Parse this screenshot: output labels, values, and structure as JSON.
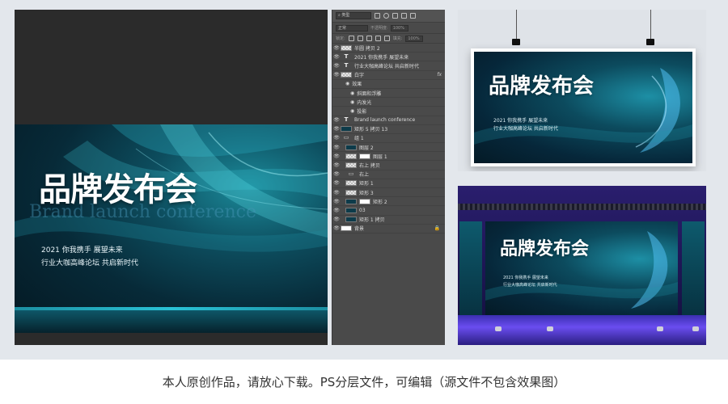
{
  "artwork": {
    "title": "品牌发布会",
    "subtitle_en": "Brand launch conference",
    "line1": "2021 你我携手 展望未来",
    "line2": "行业大咖高峰论坛 共启新时代"
  },
  "layers_panel": {
    "filter_label": "类型",
    "blend_mode": "正常",
    "opacity_label": "不透明度:",
    "opacity_value": "100%",
    "lock_label": "锁定:",
    "fill_label": "填充:",
    "fill_value": "100%",
    "layers": [
      {
        "name": "半圆 拷贝 2",
        "thumb": "checker",
        "indent": 0
      },
      {
        "name": "2021 你我携手 展望未来",
        "thumb": "text",
        "indent": 0
      },
      {
        "name": "行业大咖高峰论坛 共启新时代",
        "thumb": "text",
        "indent": 0
      },
      {
        "name": "白字",
        "thumb": "checker",
        "indent": 0,
        "fx": "fx"
      },
      {
        "name": "效果",
        "thumb": "none",
        "indent": 1
      },
      {
        "name": "斜面和浮雕",
        "thumb": "none",
        "indent": 2
      },
      {
        "name": "内发光",
        "thumb": "none",
        "indent": 2
      },
      {
        "name": "投影",
        "thumb": "none",
        "indent": 2
      },
      {
        "name": "Brand launch conference",
        "thumb": "text",
        "indent": 0
      },
      {
        "name": "矩形 5 拷贝 13",
        "thumb": "dark",
        "indent": 0
      },
      {
        "name": "组 1",
        "thumb": "folder",
        "indent": 0
      },
      {
        "name": "图层 2",
        "thumb": "dark",
        "indent": 1
      },
      {
        "name": "图层 1",
        "thumb": "checker",
        "indent": 1,
        "mask": true
      },
      {
        "name": "右上 拷贝",
        "thumb": "checker",
        "indent": 1
      },
      {
        "name": "右上",
        "thumb": "folder",
        "indent": 1
      },
      {
        "name": "矩形 1",
        "thumb": "checker",
        "indent": 1
      },
      {
        "name": "矩形 3",
        "thumb": "checker",
        "indent": 1
      },
      {
        "name": "矩形 2",
        "thumb": "dark",
        "indent": 1,
        "mask": true
      },
      {
        "name": "03",
        "thumb": "dark",
        "indent": 1
      },
      {
        "name": "矩形 1 拷贝",
        "thumb": "dark",
        "indent": 1
      },
      {
        "name": "背景",
        "thumb": "white",
        "indent": 0,
        "locked": true
      }
    ]
  },
  "caption": "本人原创作品，请放心下载。PS分层文件，可编辑（源文件不包含效果图）",
  "colors": {
    "accent_teal": "#1c8fa2",
    "panel_bg": "#4a4a4a",
    "stage_purple": "#2a1e6e"
  }
}
